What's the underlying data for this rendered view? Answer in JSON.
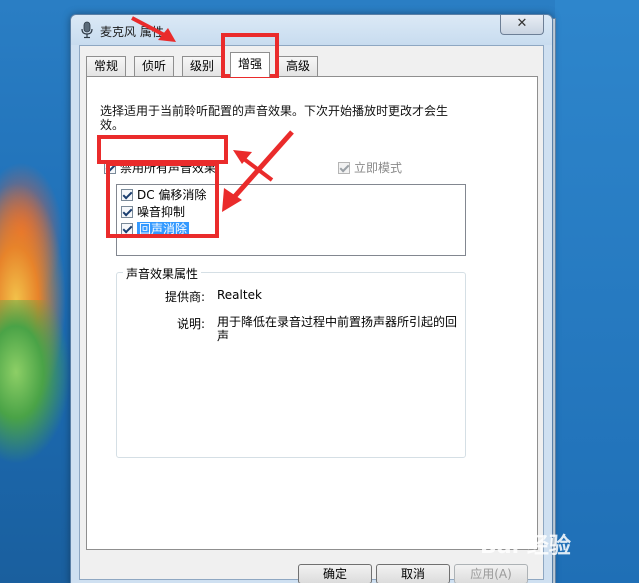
{
  "window": {
    "title": "麦克风 属性",
    "close_label": "✕"
  },
  "tabs": [
    {
      "label": "常规",
      "active": false
    },
    {
      "label": "侦听",
      "active": false
    },
    {
      "label": "级别",
      "active": false
    },
    {
      "label": "增强",
      "active": true
    },
    {
      "label": "高级",
      "active": false
    }
  ],
  "enhancements": {
    "description": "选择适用于当前聆听配置的声音效果。下次开始播放时更改才会生效。",
    "disable_all": {
      "label": "禁用所有声音效果",
      "checked": true
    },
    "immediate_mode": {
      "label": "立即模式",
      "checked": true,
      "enabled": false
    },
    "effects": [
      {
        "label": "DC 偏移消除",
        "checked": true,
        "selected": false
      },
      {
        "label": "噪音抑制",
        "checked": true,
        "selected": false
      },
      {
        "label": "回声消除",
        "checked": true,
        "selected": true
      }
    ],
    "properties": {
      "group_label": "声音效果属性",
      "provider_label": "提供商:",
      "provider_value": "Realtek",
      "description_label": "说明:",
      "description_value": "用于降低在录音过程中前置扬声器所引起的回声"
    }
  },
  "buttons": {
    "ok": "确定",
    "cancel": "取消",
    "apply": "应用(A)"
  },
  "watermark": {
    "text": "Bai 经验"
  },
  "colors": {
    "annotation_red": "#ea2b2b",
    "selection_blue": "#3399ff"
  }
}
